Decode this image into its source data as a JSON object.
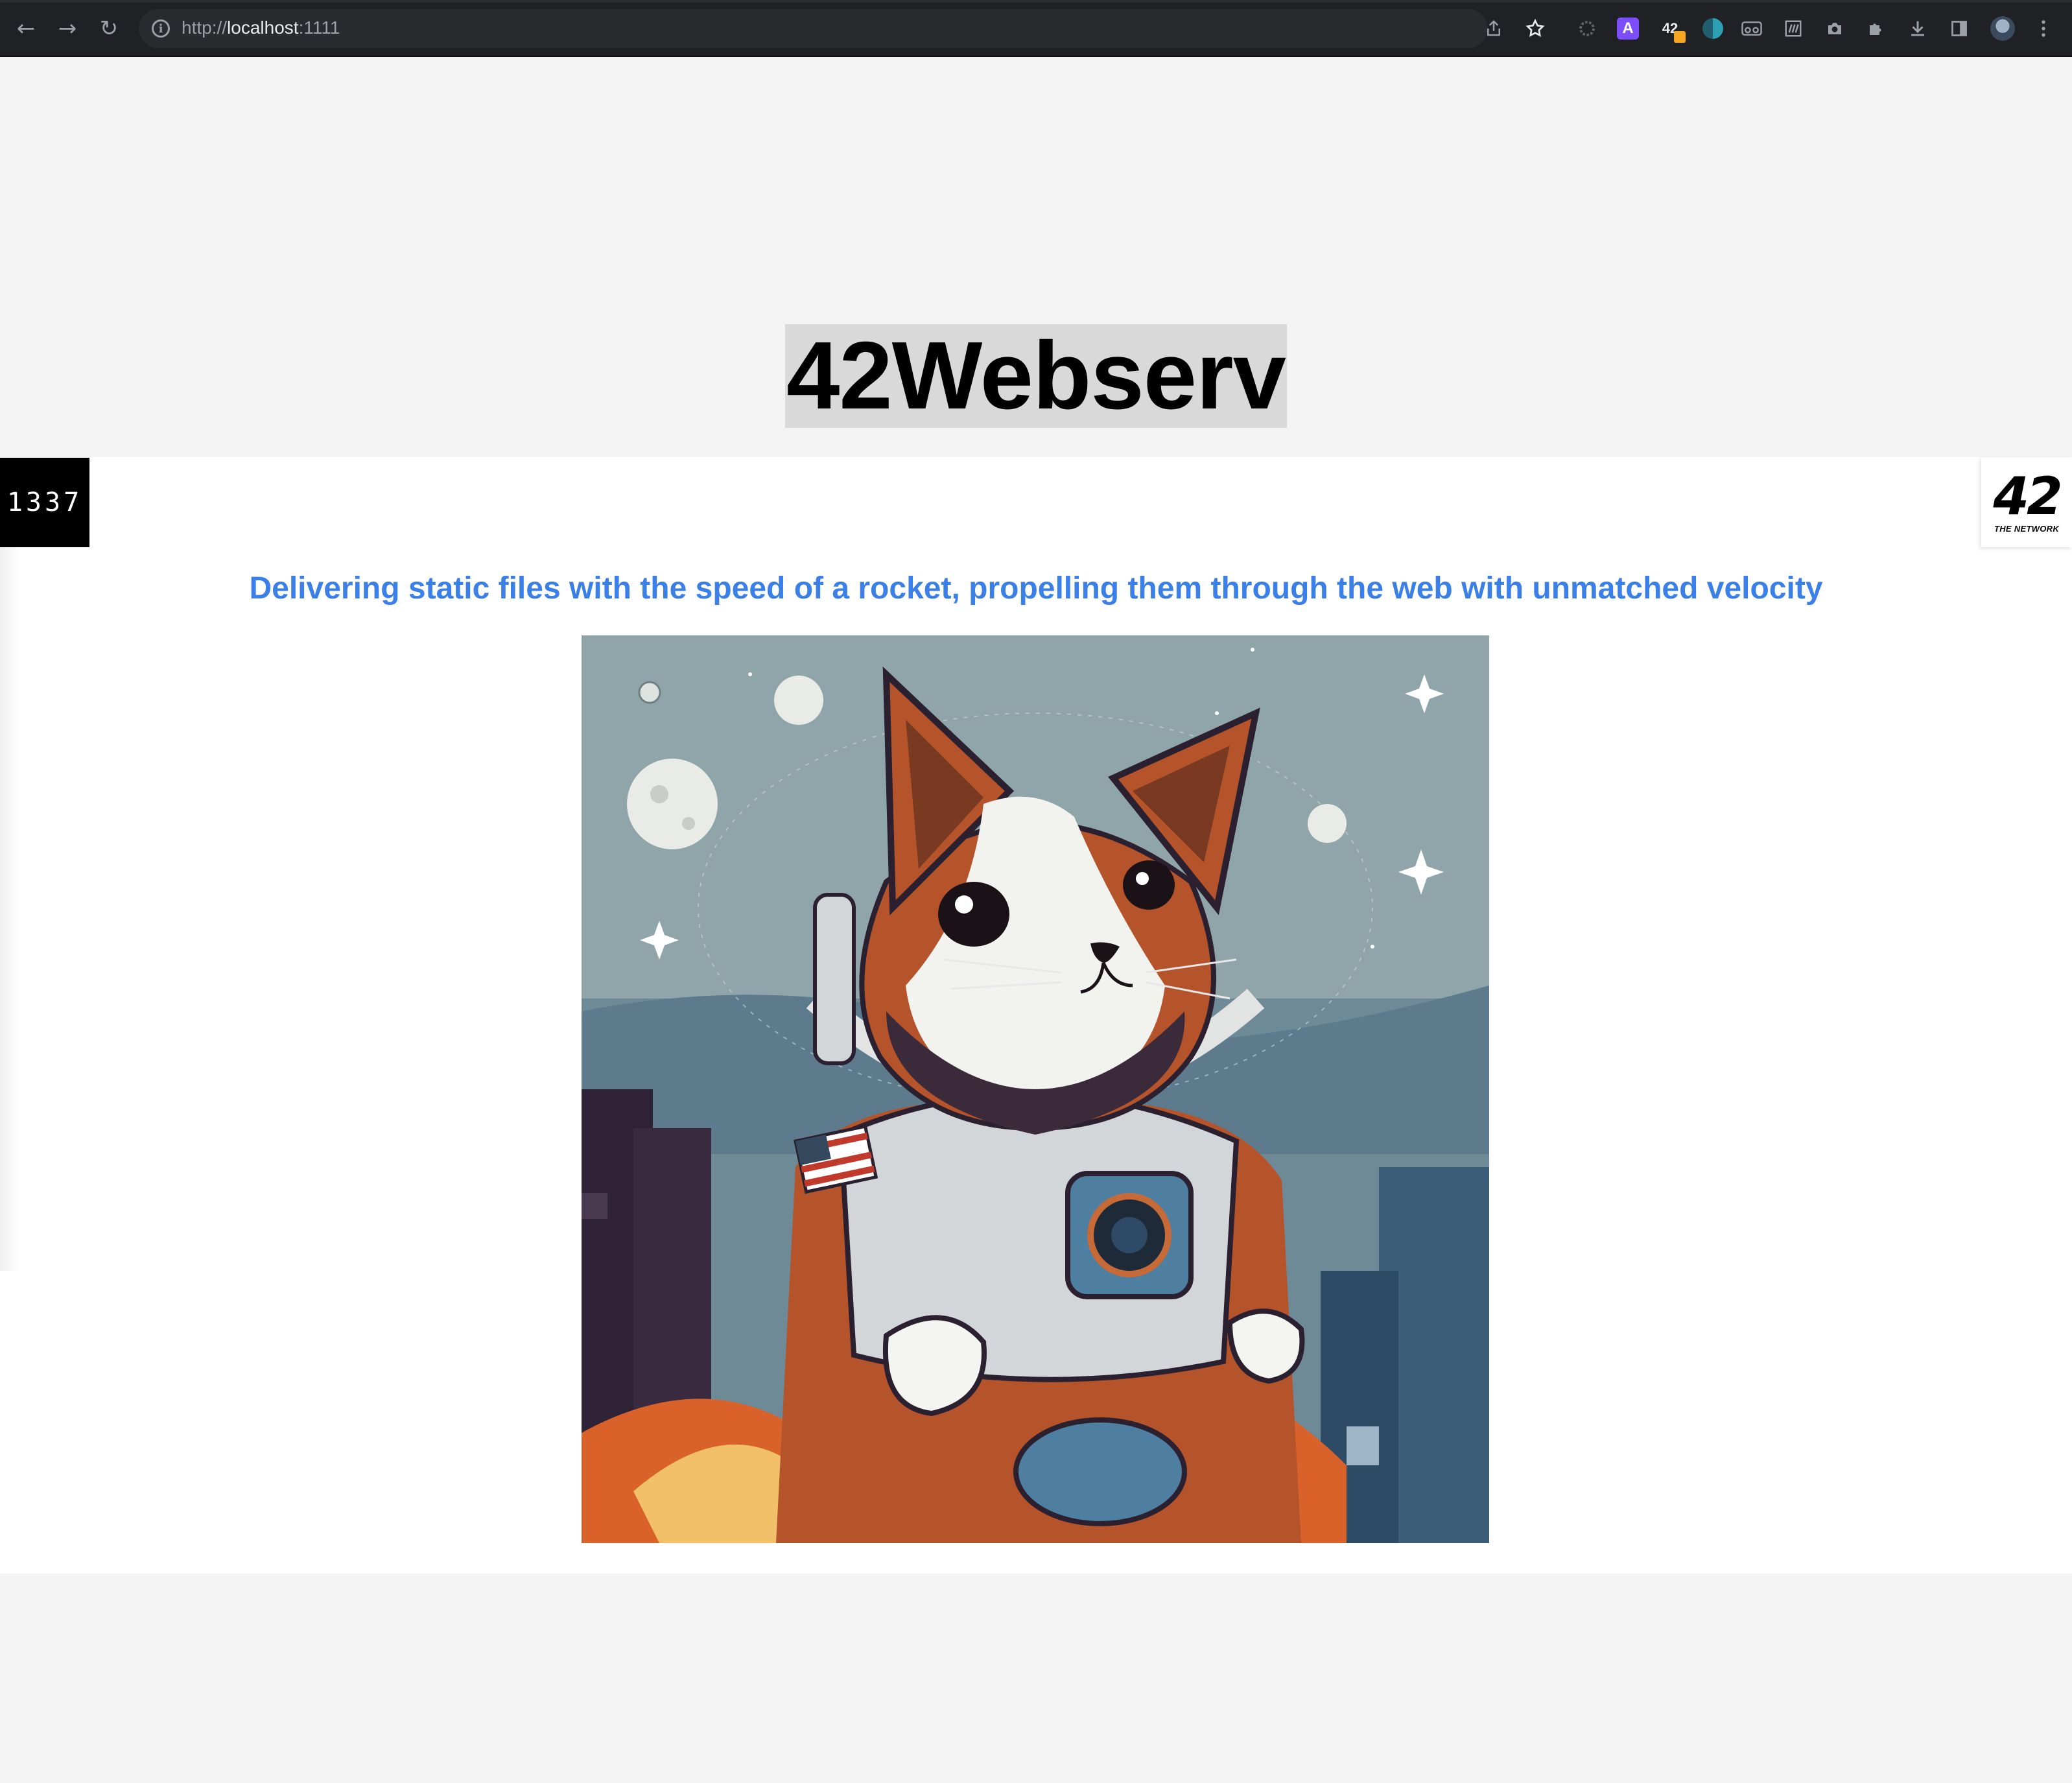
{
  "browser": {
    "url_scheme": "http://",
    "url_host": "localhost",
    "url_port": ":1111",
    "nav": {
      "back_icon": "arrow-left-icon",
      "forward_icon": "arrow-right-icon",
      "reload_icon": "reload-icon"
    },
    "extensions": [
      "share-icon",
      "bookmark-star-icon",
      "extension-ring-icon",
      "extension-a-icon",
      "extension-42-icon",
      "extension-circle-icon",
      "extension-glasses-icon",
      "extension-w-icon",
      "camera-icon",
      "puzzle-icon",
      "download-icon",
      "side-panel-icon",
      "profile-avatar-icon",
      "more-menu-icon"
    ],
    "ext_a_label": "A",
    "ext_42_label": "42"
  },
  "page": {
    "title": "42Webserv",
    "tagline": "Delivering static files with the speed of a rocket, propelling them through the web with unmatched velocity",
    "logo_left": "1337",
    "logo_right_num": "42",
    "logo_right_sub": "THE NETWORK",
    "hero_image": "astronaut-cat-illustration"
  },
  "colors": {
    "tagline": "#3b7fe8",
    "title_bg": "#d9d9d9",
    "page_bg": "#f4f4f4",
    "chrome_bg": "#202124"
  }
}
